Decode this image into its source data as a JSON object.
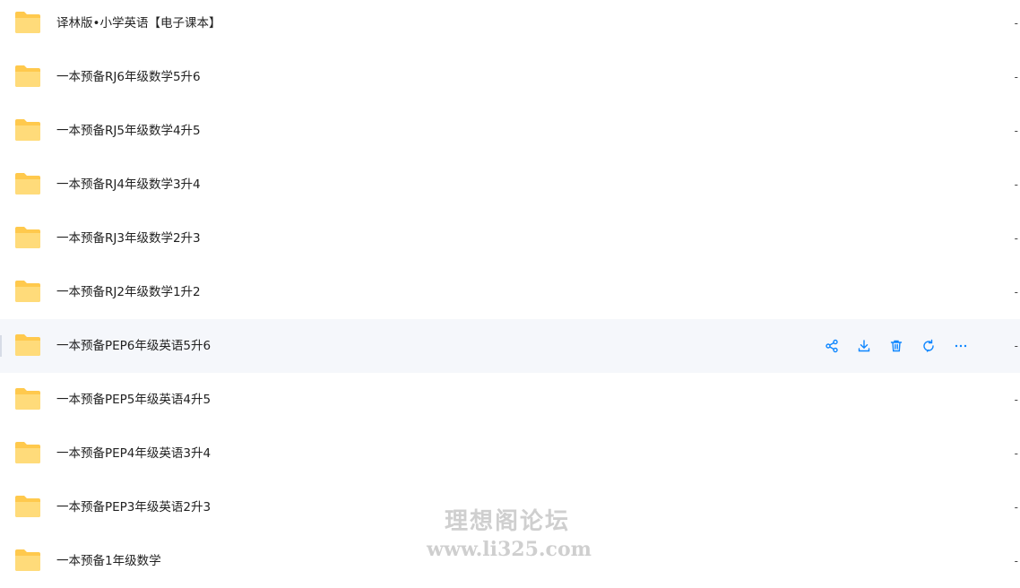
{
  "files": [
    {
      "name": "译林版•小学英语【电子课本】",
      "meta": "-"
    },
    {
      "name": "一本预备RJ6年级数学5升6",
      "meta": "-"
    },
    {
      "name": "一本预备RJ5年级数学4升5",
      "meta": "-"
    },
    {
      "name": "一本预备RJ4年级数学3升4",
      "meta": "-"
    },
    {
      "name": "一本预备RJ3年级数学2升3",
      "meta": "-"
    },
    {
      "name": "一本预备RJ2年级数学1升2",
      "meta": "-"
    },
    {
      "name": "一本预备PEP6年级英语5升6",
      "meta": "-"
    },
    {
      "name": "一本预备PEP5年级英语4升5",
      "meta": "-"
    },
    {
      "name": "一本预备PEP4年级英语3升4",
      "meta": "-"
    },
    {
      "name": "一本预备PEP3年级英语2升3",
      "meta": "-"
    },
    {
      "name": "一本预备1年级数学",
      "meta": "-"
    }
  ],
  "hover_row_actions": [
    "share-icon",
    "download-icon",
    "delete-icon",
    "sync-icon",
    "more-icon"
  ],
  "colors": {
    "folder": "#ffd266",
    "accent": "#0d86ff",
    "hover_bg": "#f5f7fb"
  },
  "watermark": {
    "line1": "理想阁论坛",
    "line2": "www.li325.com"
  }
}
